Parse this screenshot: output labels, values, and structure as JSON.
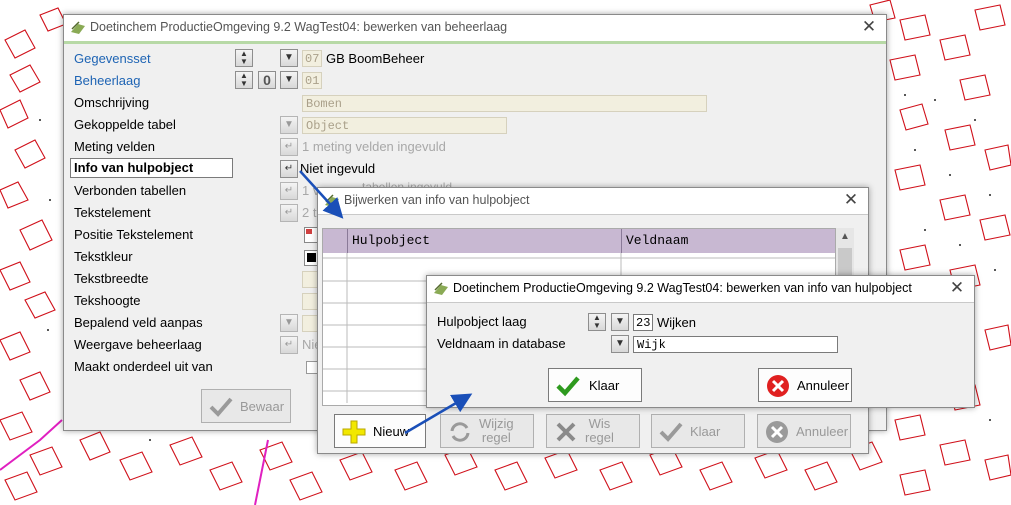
{
  "main_window": {
    "title": "Doetinchem ProductieOmgeving 9.2 WagTest04: bewerken van beheerlaag",
    "labels": [
      "Gegevensset",
      "Beheerlaag",
      "Omschrijving",
      "Gekoppelde tabel",
      "Meting velden",
      "Info van hulpobject",
      "Verbonden tabellen",
      "Tekstelement",
      "Positie Tekstelement",
      "Tekstkleur",
      "Tekstbreedte",
      "Tekshoogte",
      "Bepalend veld aanpas",
      "Weergave beheerlaag",
      "Maakt onderdeel uit van"
    ],
    "gegevensset_num": "07",
    "gegevensset_name": "GB BoomBeheer",
    "beheerlaag_num": "01",
    "omschrijving": "Bomen",
    "gekoppelde_tabel": "Object",
    "meting_velden": "1 meting velden ingevuld",
    "info_hulpobject": "Niet ingevuld",
    "verbonden_tabellen": "1 v",
    "verbonden_tabellen_tail": "tabellen ingevuld",
    "tekstelement": "2 t",
    "weergave": "Nie",
    "bewaar_label": "Bewaar"
  },
  "info_window": {
    "title": "Bijwerken van info van hulpobject",
    "col_hulpobject": "Hulpobject",
    "col_veldnaam": "Veldnaam",
    "nieuw_label": "Nieuw",
    "wijzig_label": "Wijzig\nregel",
    "wis_label": "Wis\nregel",
    "klaar_label": "Klaar",
    "annuleer_label": "Annuleer"
  },
  "edit_window": {
    "title": "Doetinchem ProductieOmgeving 9.2 WagTest04: bewerken van info van hulpobject",
    "label_laag": "Hulpobject laag",
    "label_veldnaam": "Veldnaam in database",
    "laag_num": "23",
    "laag_name": "Wijken",
    "veldnaam_value": "Wijk",
    "klaar_label": "Klaar",
    "annuleer_label": "Annuleer"
  },
  "colors": {
    "accent_blue": "#1e64b4",
    "grid_header": "#c8b8d2",
    "map_lines": "#d0101a",
    "arrow": "#1a4fb8"
  }
}
